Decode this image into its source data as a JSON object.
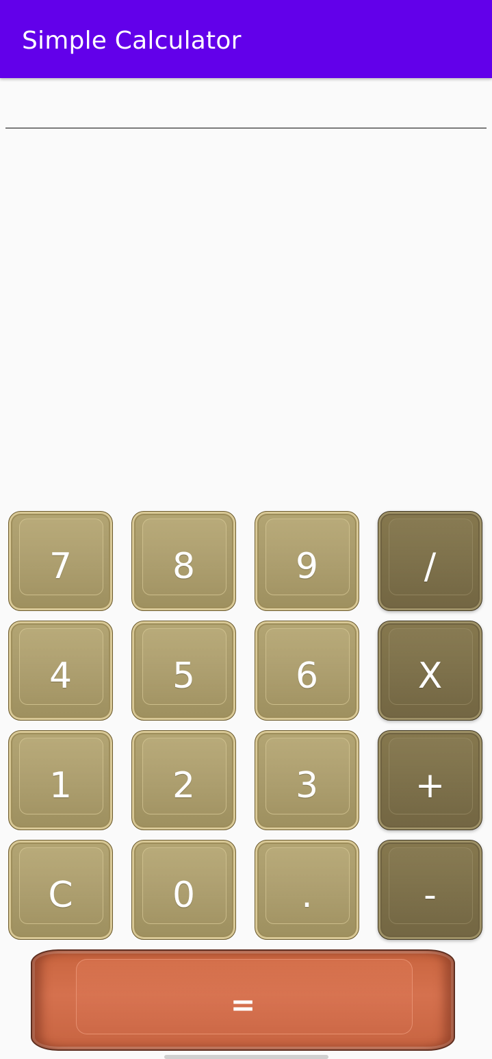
{
  "app_bar": {
    "title": "Simple Calculator",
    "background_color": "#6200ea"
  },
  "display": {
    "value": "",
    "placeholder": ""
  },
  "keypad": {
    "rows": [
      [
        {
          "label": "7",
          "name": "key-7",
          "style": "light"
        },
        {
          "label": "8",
          "name": "key-8",
          "style": "light"
        },
        {
          "label": "9",
          "name": "key-9",
          "style": "light"
        },
        {
          "label": "/",
          "name": "divide-key",
          "style": "dark"
        }
      ],
      [
        {
          "label": "4",
          "name": "key-4",
          "style": "light"
        },
        {
          "label": "5",
          "name": "key-5",
          "style": "light"
        },
        {
          "label": "6",
          "name": "key-6",
          "style": "light"
        },
        {
          "label": "X",
          "name": "multiply-key",
          "style": "dark"
        }
      ],
      [
        {
          "label": "1",
          "name": "key-1",
          "style": "light"
        },
        {
          "label": "2",
          "name": "key-2",
          "style": "light"
        },
        {
          "label": "3",
          "name": "key-3",
          "style": "light"
        },
        {
          "label": "+",
          "name": "add-key",
          "style": "dark"
        }
      ],
      [
        {
          "label": "C",
          "name": "clear-key",
          "style": "light"
        },
        {
          "label": "0",
          "name": "key-0",
          "style": "light"
        },
        {
          "label": ".",
          "name": "decimal-key",
          "style": "light"
        },
        {
          "label": "-",
          "name": "subtract-key",
          "style": "dark"
        }
      ]
    ],
    "equals_label": "=",
    "colors": {
      "light_key": "#a99b6c",
      "operator_key": "#7c6f48",
      "equals_key": "#d5714e"
    }
  }
}
